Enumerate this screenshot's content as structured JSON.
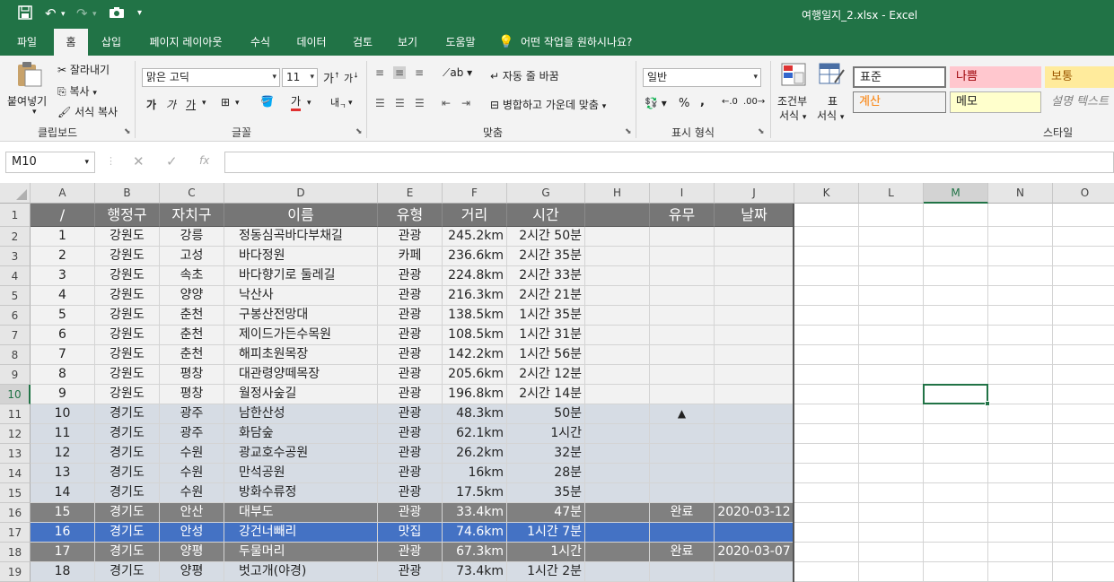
{
  "title_bar": {
    "filename": "여행일지_2.xlsx  -  Excel",
    "qat": {
      "save": "save-icon",
      "undo": "undo-icon",
      "redo": "redo-icon",
      "camera": "camera-icon",
      "customize": "▾"
    }
  },
  "tabs": [
    {
      "label": "파일"
    },
    {
      "label": "홈"
    },
    {
      "label": "삽입"
    },
    {
      "label": "페이지 레이아웃"
    },
    {
      "label": "수식"
    },
    {
      "label": "데이터"
    },
    {
      "label": "검토"
    },
    {
      "label": "보기"
    },
    {
      "label": "도움말"
    },
    {
      "label": "어떤 작업을 원하시나요?"
    }
  ],
  "ribbon": {
    "clipboard": {
      "paste": "붙여넣기",
      "cut": "잘라내기",
      "copy": "복사",
      "format_painter": "서식 복사",
      "label": "클립보드"
    },
    "font": {
      "name": "맑은 고딕",
      "size": "11",
      "label": "글꼴"
    },
    "alignment": {
      "wrap": "자동 줄 바꿈",
      "merge": "병합하고 가운데 맞춤",
      "label": "맞춤"
    },
    "number": {
      "format": "일반",
      "percent": "%",
      "comma": ",",
      "label": "표시 형식"
    },
    "styles": {
      "conditional_1": "조건부",
      "conditional_2": "서식",
      "table_1": "표",
      "table_2": "서식",
      "normal": "표준",
      "bad": "나쁨",
      "neutral": "보통",
      "calc": "계산",
      "note": "메모",
      "explanatory": "설명 텍스트",
      "label": "스타일"
    }
  },
  "formula_bar": {
    "name_box": "M10",
    "formula": "",
    "fx": "fx"
  },
  "columns": [
    "A",
    "B",
    "C",
    "D",
    "E",
    "F",
    "G",
    "H",
    "I",
    "J",
    "K",
    "L",
    "M",
    "N",
    "O"
  ],
  "selected_column": "M",
  "selected_row": "10",
  "header_row": {
    "A": "/",
    "B": "행정구",
    "C": "자치구",
    "D": "이름",
    "E": "유형",
    "F": "거리",
    "G": "시간",
    "H": "",
    "I": "유무",
    "J": "날짜"
  },
  "rows": [
    {
      "n": "2",
      "A": "1",
      "B": "강원도",
      "C": "강릉",
      "D": "정동심곡바다부채길",
      "E": "관광",
      "F": "245.2km",
      "G": "2시간 50분",
      "I": "",
      "J": "",
      "style": "light"
    },
    {
      "n": "3",
      "A": "2",
      "B": "강원도",
      "C": "고성",
      "D": "바다정원",
      "E": "카페",
      "F": "236.6km",
      "G": "2시간 35분",
      "I": "",
      "J": "",
      "style": "light"
    },
    {
      "n": "4",
      "A": "3",
      "B": "강원도",
      "C": "속초",
      "D": "바다향기로 둘레길",
      "E": "관광",
      "F": "224.8km",
      "G": "2시간 33분",
      "I": "",
      "J": "",
      "style": "light"
    },
    {
      "n": "5",
      "A": "4",
      "B": "강원도",
      "C": "양양",
      "D": "낙산사",
      "E": "관광",
      "F": "216.3km",
      "G": "2시간 21분",
      "I": "",
      "J": "",
      "style": "light"
    },
    {
      "n": "6",
      "A": "5",
      "B": "강원도",
      "C": "춘천",
      "D": "구봉산전망대",
      "E": "관광",
      "F": "138.5km",
      "G": "1시간 35분",
      "I": "",
      "J": "",
      "style": "light"
    },
    {
      "n": "7",
      "A": "6",
      "B": "강원도",
      "C": "춘천",
      "D": "제이드가든수목원",
      "E": "관광",
      "F": "108.5km",
      "G": "1시간 31분",
      "I": "",
      "J": "",
      "style": "light"
    },
    {
      "n": "8",
      "A": "7",
      "B": "강원도",
      "C": "춘천",
      "D": "해피초원목장",
      "E": "관광",
      "F": "142.2km",
      "G": "1시간 56분",
      "I": "",
      "J": "",
      "style": "light"
    },
    {
      "n": "9",
      "A": "8",
      "B": "강원도",
      "C": "평창",
      "D": "대관령양떼목장",
      "E": "관광",
      "F": "205.6km",
      "G": "2시간 12분",
      "I": "",
      "J": "",
      "style": "light"
    },
    {
      "n": "10",
      "A": "9",
      "B": "강원도",
      "C": "평창",
      "D": "월정사숲길",
      "E": "관광",
      "F": "196.8km",
      "G": "2시간 14분",
      "I": "",
      "J": "",
      "style": "light"
    },
    {
      "n": "11",
      "A": "10",
      "B": "경기도",
      "C": "광주",
      "D": "남한산성",
      "E": "관광",
      "F": "48.3km",
      "G": "50분",
      "I": "▲",
      "J": "",
      "style": "blue"
    },
    {
      "n": "12",
      "A": "11",
      "B": "경기도",
      "C": "광주",
      "D": "화담숲",
      "E": "관광",
      "F": "62.1km",
      "G": "1시간",
      "I": "",
      "J": "",
      "style": "blue"
    },
    {
      "n": "13",
      "A": "12",
      "B": "경기도",
      "C": "수원",
      "D": "광교호수공원",
      "E": "관광",
      "F": "26.2km",
      "G": "32분",
      "I": "",
      "J": "",
      "style": "blue"
    },
    {
      "n": "14",
      "A": "13",
      "B": "경기도",
      "C": "수원",
      "D": "만석공원",
      "E": "관광",
      "F": "16km",
      "G": "28분",
      "I": "",
      "J": "",
      "style": "blue"
    },
    {
      "n": "15",
      "A": "14",
      "B": "경기도",
      "C": "수원",
      "D": "방화수류정",
      "E": "관광",
      "F": "17.5km",
      "G": "35분",
      "I": "",
      "J": "",
      "style": "blue"
    },
    {
      "n": "16",
      "A": "15",
      "B": "경기도",
      "C": "안산",
      "D": "대부도",
      "E": "관광",
      "F": "33.4km",
      "G": "47분",
      "I": "완료",
      "J": "2020-03-12",
      "style": "gray"
    },
    {
      "n": "17",
      "A": "16",
      "B": "경기도",
      "C": "안성",
      "D": "강건너빼리",
      "E": "맛집",
      "F": "74.6km",
      "G": "1시간 7분",
      "I": "",
      "J": "",
      "style": "sel"
    },
    {
      "n": "18",
      "A": "17",
      "B": "경기도",
      "C": "양평",
      "D": "두물머리",
      "E": "관광",
      "F": "67.3km",
      "G": "1시간",
      "I": "완료",
      "J": "2020-03-07",
      "style": "gray"
    },
    {
      "n": "19",
      "A": "18",
      "B": "경기도",
      "C": "양평",
      "D": "벗고개(야경)",
      "E": "관광",
      "F": "73.4km",
      "G": "1시간 2분",
      "I": "",
      "J": "",
      "style": "blue"
    }
  ],
  "colors": {
    "accent": "#217346",
    "header_fill": "#767676",
    "row_light": "#f2f2f2",
    "row_blue": "#d6dce4",
    "row_gray": "#808080",
    "row_selected": "#4472c4"
  }
}
